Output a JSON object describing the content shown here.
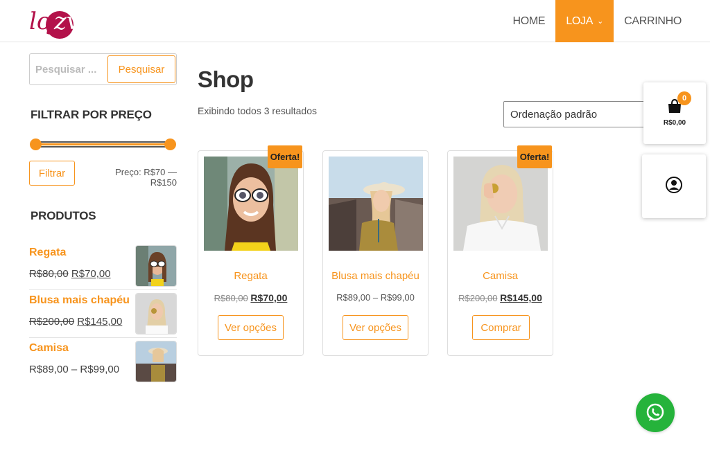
{
  "brand": {
    "logo_text": "lojzvi",
    "logo_color": "#b3124a",
    "accent": "#f7941d"
  },
  "nav": {
    "items": [
      {
        "label": "HOME"
      },
      {
        "label": "LOJA",
        "active": true
      },
      {
        "label": "CARRINHO"
      }
    ]
  },
  "search": {
    "placeholder": "Pesquisar ...",
    "button_label": "Pesquisar"
  },
  "price_filter": {
    "title": "FILTRAR POR PREÇO",
    "min_level": 0,
    "max_level": 1,
    "button_label": "Filtrar",
    "range_text": "Preço: R$70 — R$150"
  },
  "products_widget": {
    "title": "PRODUTOS",
    "items": [
      {
        "name": "Regata",
        "old_price": "R$80,00",
        "price": "R$70,00"
      },
      {
        "name": "Blusa mais chapéu",
        "old_price": "R$200,00",
        "price": "R$145,00"
      },
      {
        "name": "Camisa",
        "price": "R$89,00 – R$99,00"
      }
    ]
  },
  "main": {
    "title": "Shop",
    "result_count": "Exibindo todos 3 resultados",
    "ordering": "Ordenação padrão",
    "products": [
      {
        "name": "Regata",
        "badge": "Oferta!",
        "old_price": "R$80,00",
        "price": "R$70,00",
        "button": "Ver opções"
      },
      {
        "name": "Blusa mais chapéu",
        "badge": "",
        "price_range": "R$89,00 – R$99,00",
        "button": "Ver opções"
      },
      {
        "name": "Camisa",
        "badge": "Oferta!",
        "old_price": "R$200,00",
        "price": "R$145,00",
        "button": "Comprar"
      }
    ]
  },
  "floating": {
    "cart_count": "0",
    "cart_total": "R$0,00",
    "cart_icon": "shopping-bag-icon",
    "account_icon": "user-circle-icon",
    "whatsapp_icon": "whatsapp-icon",
    "whatsapp_color": "#25b33b"
  }
}
